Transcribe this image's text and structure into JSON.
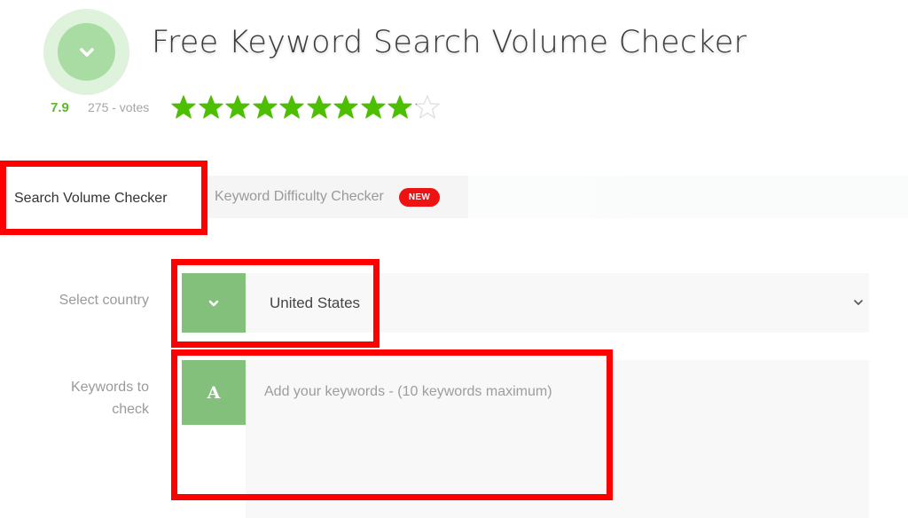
{
  "header": {
    "logo_icon": "chevron-down-icon",
    "title": "Free Keyword Search Volume Checker",
    "rating": {
      "value": "7.9",
      "votes": "275 - votes",
      "stars_total": 10,
      "stars_filled": 9.1,
      "star_color": "#4cbf00",
      "star_empty_color": "#e2e2e2"
    }
  },
  "tabs": [
    {
      "label": "Search Volume Checker",
      "active": true
    },
    {
      "label": "Keyword Difficulty Checker",
      "active": false,
      "badge": "NEW"
    }
  ],
  "form": {
    "country": {
      "label": "Select country",
      "addon_icon": "chevron-down-icon",
      "value": "United States",
      "caret_icon": "chevron-down-icon"
    },
    "keywords": {
      "label": "Keywords to check",
      "addon_icon": "letter-a-icon",
      "addon_glyph": "A",
      "placeholder": "Add your keywords - (10 keywords maximum)",
      "value": ""
    }
  },
  "colors": {
    "accent_green": "#82c07b",
    "badge_red": "#ee1212",
    "annotation_red": "#ff0000",
    "rating_green": "#5cb82e"
  }
}
